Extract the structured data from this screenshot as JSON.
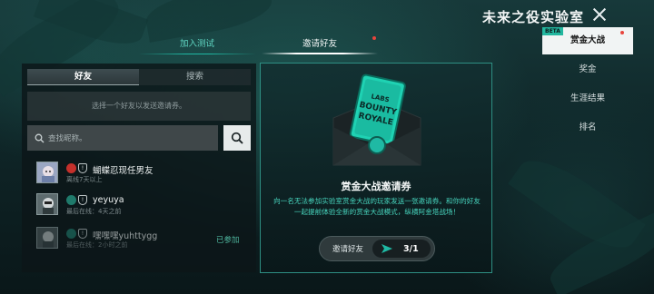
{
  "header": {
    "title": "未来之役实验室"
  },
  "top_tabs": [
    {
      "label": "加入测试",
      "active": false
    },
    {
      "label": "邀请好友",
      "active": true,
      "has_notification": true
    }
  ],
  "friends_panel": {
    "tabs": [
      {
        "label": "好友",
        "active": true
      },
      {
        "label": "搜索",
        "active": false
      }
    ],
    "hint": "选择一个好友以发送邀请券。",
    "search": {
      "placeholder": "查找昵称。"
    },
    "friends": [
      {
        "name": "蝴蝶忍现任男友",
        "status": "离线7天以上",
        "joined_label": ""
      },
      {
        "name": "yeyuya",
        "status": "最后在线：4天之前",
        "joined_label": ""
      },
      {
        "name": "嘿嘿嘿yuhttygg",
        "status": "最后在线：2小时之前",
        "joined_label": "已参加"
      }
    ]
  },
  "invite_card": {
    "ticket_text": [
      "LABS",
      "BOUNTY",
      "ROYALE"
    ],
    "title": "赏金大战邀请券",
    "description": "向一名无法参加实验室赏金大战的玩家发送一张邀请券。和你的好友一起提前体验全新的赏金大战模式，纵横阿金塔战场！",
    "invite_button_label": "邀请好友",
    "invite_count": "3/1"
  },
  "side_nav": {
    "items": [
      {
        "label": "赏金大战",
        "active": true,
        "tag": "BETA",
        "has_notification": true
      },
      {
        "label": "奖金",
        "active": false
      },
      {
        "label": "生涯结果",
        "active": false
      },
      {
        "label": "排名",
        "active": false
      }
    ]
  },
  "colors": {
    "accent": "#1fb9a4",
    "accent_text": "#47d5be",
    "notification": "#e8453c"
  }
}
